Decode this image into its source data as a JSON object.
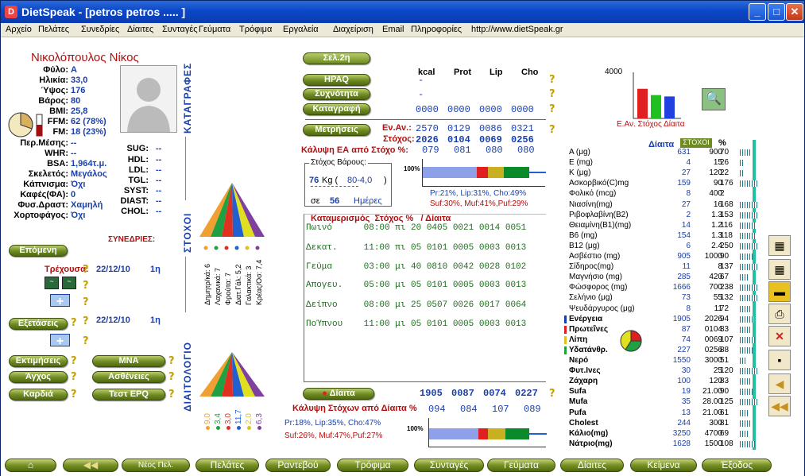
{
  "window": {
    "title": "DietSpeak - [petros petros ..... ]",
    "min": "_",
    "max": "□",
    "close": "✕"
  },
  "menu": [
    "Αρχείο",
    "Πελάτες",
    "Συνεδρίες",
    "Δίαιτες",
    "Συνταγές",
    "Γεύματα",
    "Τρόφιμα",
    "Εργαλεία",
    "Διαχείριση",
    "Email",
    "Πληροφορίες",
    "http://www.dietSpeak.gr"
  ],
  "patient": {
    "name": "Νικολόπουλος Νίκος",
    "fields": [
      [
        "Φύλο:",
        "Α"
      ],
      [
        "Ηλικία:",
        "33,0"
      ],
      [
        "Ύψος:",
        "176"
      ],
      [
        "Βάρος:",
        "80"
      ],
      [
        "BMI:",
        "25,8"
      ],
      [
        "FFM:",
        "62 (78%)"
      ],
      [
        "FM:",
        "18 (23%)"
      ],
      [
        "Περ.Μέσης:",
        "--"
      ],
      [
        "WHR:",
        "--"
      ],
      [
        "BSA:",
        "1,964τ.μ."
      ],
      [
        "Σκελετός:",
        "Μεγάλος"
      ],
      [
        "Κάπνισμα:",
        "Όχι"
      ],
      [
        "Καφές(ΦΑ):",
        "0"
      ],
      [
        "Φυσ.Δραστ:",
        "Χαμηλή"
      ],
      [
        "Χορτοφάγος:",
        "Όχι"
      ]
    ],
    "labs": [
      [
        "SUG:",
        "--"
      ],
      [
        "HDL:",
        "--"
      ],
      [
        "LDL:",
        "--"
      ],
      [
        "TGL:",
        "--"
      ],
      [
        "SYST:",
        "--"
      ],
      [
        "DIAST:",
        "--"
      ],
      [
        "CHOL:",
        "--"
      ]
    ]
  },
  "side_tabs": {
    "katagrafes": "ΚΑΤΑΓΡΑΦΕΣ",
    "stoxoi": "ΣΤΟΧΟΙ",
    "diaitologio": "ΔΙΑΙΤΟΛΟΓΙΟ"
  },
  "sessions": {
    "title": "ΣΥΝΕΔΡΙΕΣ:",
    "next": "Επόμενη",
    "current_label": "Τρέχουσα:",
    "current_date": "22/12/10",
    "current_day": "1η",
    "exams": "Εξετάσεις",
    "exams_date": "22/12/10",
    "exams_day": "1η",
    "plus": "+"
  },
  "left_buttons": [
    "Εκτιμήσεις",
    "MNA",
    "Άγχος",
    "Ασθένειες",
    "Καρδιά",
    "Τεστ EPQ"
  ],
  "pyramid_top_labels": [
    "Δημητρ/κά: 6",
    "Λαχανικά: 7",
    "Φρούτα: 7",
    "Διατ.Γάλ: 5,2",
    "Γαλακτικά: 3",
    "Κρέας/Οσ: 7,4"
  ],
  "pyramid_bot_labels": [
    "9,0",
    "3,4",
    "3,0",
    "11,7",
    "2,0",
    "6,3"
  ],
  "center": {
    "page_btn": "Σελ.2η",
    "cols": [
      "kcal",
      "Prot",
      "Lip",
      "Cho"
    ],
    "rows": [
      {
        "btn": "HPAQ",
        "vals": [
          "-"
        ]
      },
      {
        "btn": "Συχνότητα",
        "vals": [
          "-"
        ]
      },
      {
        "btn": "Καταγραφή",
        "vals": [
          "0000",
          "0000",
          "0000",
          "0000"
        ]
      }
    ],
    "metriseis": "Μετρήσεις",
    "en_av_label": "Εν.Αν.:",
    "en_av": [
      "2570",
      "0129",
      "0086",
      "0321"
    ],
    "stoxos_label": "Στόχος:",
    "stoxos": [
      "2026",
      "0104",
      "0069",
      "0256"
    ],
    "kalypsi_label": "Κάλυψη ΕΑ από Στόχο %:",
    "kalypsi": [
      "079",
      "081",
      "080",
      "080"
    ],
    "weight_box": {
      "title": "Στόχος Βάρους:",
      "kg": "76",
      "kg_unit": "Kg (",
      "range": "80-4,0",
      "close": ")",
      "se": "σε",
      "days": "56",
      "days_label": "Ημέρες"
    },
    "macro1_line1": "Pr:21%, Lip:31%, Cho:49%",
    "macro1_line2": "Suf:30%, Muf:41%,Puf:29%",
    "meals_header": "Καταμερισμός  Στόχος %   / Δίαιτα",
    "meals": [
      "Πωινό      08:00 πι 20 0405 0021 0014 0051",
      "Δεκατ.     11:00 πι 05 0101 0005 0003 0013",
      "Γεύμα      03:00 μι 40 0810 0042 0028 0102",
      "Απογευ.    05:00 μι 05 0101 0005 0003 0013",
      "Δείπνο     08:00 μι 25 0507 0026 0017 0064",
      "ΠοΎπνου    11:00 μι 05 0101 0005 0003 0013"
    ],
    "diaita_btn": "Δίαιτα",
    "diaita_vals": [
      "1905",
      "0087",
      "0074",
      "0227"
    ],
    "kalypsi2_label": "Κάλυψη Στόχων από Δίαιτα %",
    "kalypsi2": [
      "094",
      "084",
      "107",
      "089"
    ],
    "macro2_line1": "Pr:18%, Lip:35%, Cho:47%",
    "macro2_line2": "Suf:26%, Muf:47%,Puf:27%",
    "pct100": "100%"
  },
  "mini_chart": {
    "ymax": "4000",
    "legend": "Ε.Αν. Στόχος Δίαιτα",
    "values": [
      2570,
      2026,
      1905
    ],
    "colors": [
      "#e02020",
      "#20c020",
      "#2040e0"
    ]
  },
  "nutr_header": {
    "diaita": "Δίαιτα",
    "stoxoi": "ΣΤΟΧΟΙ",
    "pct": "%"
  },
  "nutrients": [
    [
      "A (μg)",
      "631",
      "900",
      "70"
    ],
    [
      "E (mg)",
      "4",
      "15",
      "26"
    ],
    [
      "K (μg)",
      "27",
      "120",
      "22"
    ],
    [
      "Ασκορβικό(C)mg",
      "159",
      "90",
      "176"
    ],
    [
      "Φολικό (mcg)",
      "8",
      "400",
      "2"
    ],
    [
      "Νιασίνη(mg)",
      "27",
      "16",
      "168"
    ],
    [
      "Ριβοφλαβίνη(B2)",
      "2",
      "1.3",
      "153"
    ],
    [
      "Θειαμίνη(B1)(mg)",
      "14",
      "1.2",
      "116"
    ],
    [
      "B6 (mg)",
      "154",
      "1.3",
      "118"
    ],
    [
      "B12 (μg)",
      "6",
      "2.4",
      "250"
    ],
    [
      "Ασβέστιο (mg)",
      "905",
      "1000",
      "90"
    ],
    [
      "Σίδηρος(mg)",
      "11",
      "8",
      "137"
    ],
    [
      "Μαγνήσιο (mg)",
      "285",
      "420",
      "67"
    ],
    [
      "Φώσφορος (mg)",
      "1666",
      "700",
      "238"
    ],
    [
      "Σελήνιο (μg)",
      "73",
      "55",
      "132"
    ],
    [
      "Ψευδάργυρος (μg)",
      "8",
      "11",
      "72"
    ],
    [
      "Ενέργεια",
      "1905",
      "2026",
      "94"
    ],
    [
      "Πρωτεΐνες",
      "87",
      "0104",
      "83"
    ],
    [
      "Λίπη",
      "74",
      "0069",
      "107"
    ],
    [
      "Υδατάνθρ.",
      "227",
      "0256",
      "88"
    ],
    [
      "Νερό",
      "1550",
      "3000",
      "51"
    ],
    [
      "Φυτ.Ινες",
      "30",
      "25",
      "120"
    ],
    [
      "Ζάχαρη",
      "100",
      "120",
      "83"
    ],
    [
      "Sufa",
      "19",
      "21.00",
      "90"
    ],
    [
      "Mufa",
      "35",
      "28.00",
      "125"
    ],
    [
      "Pufa",
      "13",
      "21.00",
      "61"
    ],
    [
      "Cholest",
      "244",
      "300",
      "81"
    ],
    [
      "Κάλιο(mg)",
      "3250",
      "4700",
      "69"
    ],
    [
      "Νάτριο(mg)",
      "1628",
      "1500",
      "108"
    ]
  ],
  "bottom": [
    "Νέος Πελ.",
    "Πελάτες",
    "Ραντεβού",
    "Τρόφιμα",
    "Συνταγές",
    "Γεύματα",
    "Δίαιτες",
    "Κείμενα",
    "Έξοδος"
  ],
  "colors": {
    "btn_green": "#6e8a22",
    "label_red": "#b01010",
    "value_blue": "#1a3fa8",
    "meal_green": "#1f6e1f"
  }
}
